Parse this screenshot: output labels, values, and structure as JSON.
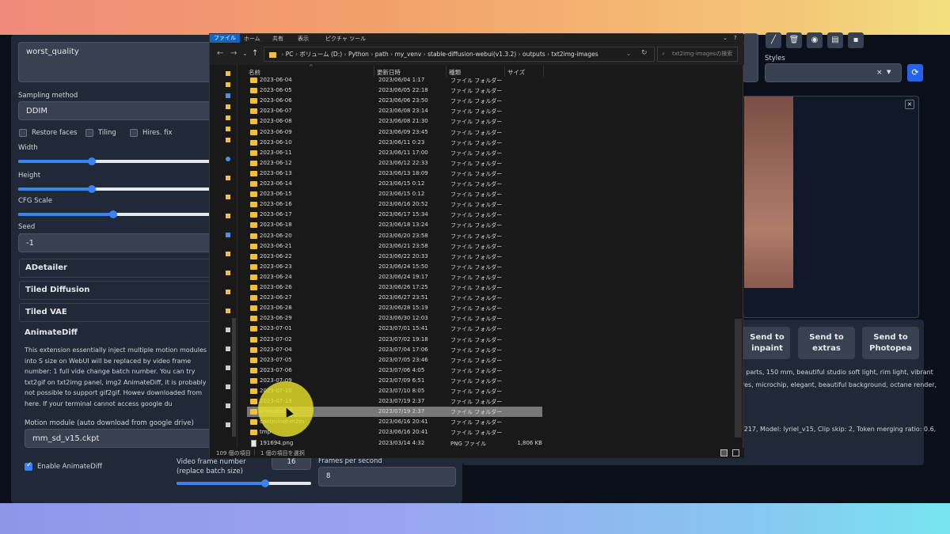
{
  "left": {
    "neg_prompt": "worst_quality",
    "sampling_label": "Sampling method",
    "sampling_value": "DDIM",
    "checks": [
      {
        "label": "Restore faces",
        "checked": false
      },
      {
        "label": "Tiling",
        "checked": false
      },
      {
        "label": "Hires. fix",
        "checked": false
      }
    ],
    "width_label": "Width",
    "height_label": "Height",
    "cfg_label": "CFG Scale",
    "seed_label": "Seed",
    "seed_value": "-1",
    "accordions": [
      "ADetailer",
      "Tiled Diffusion",
      "Tiled VAE",
      "AnimateDiff"
    ],
    "anim_text": "This extension essentially inject multiple motion modules into S size on WebUI will be replaced by video frame number: 1 full vide change batch number. You can try txt2gif on txt2img panel, img2 AnimateDiff, it is probably not possible to support gif2gif. Howev downloaded from here. If your terminal cannot access google du animatediff/model/. DO NOT change model filename.",
    "motion_label": "Motion module (auto download from google drive)",
    "motion_value": "mm_sd_v15.ckpt",
    "enable_label": "Enable AnimateDiff",
    "enable_checked": true,
    "vfn_label": "Video frame number (replace batch size)",
    "vfn_value": "16",
    "fps_label": "Frames per second",
    "fps_value": "8"
  },
  "right": {
    "toolbar_frag": "S",
    "styles_label": "Styles",
    "styles_clear": "×",
    "refresh_icon": "⟳",
    "close_icon": "×",
    "send_buttons": [
      "Send to inpaint",
      "Send to extras",
      "Send to Photopea"
    ],
    "geninfo_lines": [
      ": parts, 150 mm, beautiful studio soft light, rim light, vibrant",
      "res, microchip, elegant, beautiful background, octane render,"
    ],
    "geninfo2": ":217, Model: lyriel_v15, Clip skip: 2, Token merging ratio: 0.6,"
  },
  "explorer": {
    "ribbon": [
      "ファイル",
      "ホーム",
      "共有",
      "表示",
      "ピクチャ ツール"
    ],
    "path": [
      "PC",
      "ボリューム (D:)",
      "Python",
      "path",
      "my_venv",
      "stable-diffusion-webui(v1.3.2)",
      "outputs",
      "txt2img-images"
    ],
    "search_placeholder": "txt2img-imagesの検索",
    "columns": [
      "名前",
      "更新日時",
      "種類",
      "サイズ"
    ],
    "rows": [
      {
        "name": "2023-06-04",
        "date": "2023/06/04 1:17",
        "type": "ファイル フォルダー",
        "size": ""
      },
      {
        "name": "2023-06-05",
        "date": "2023/06/05 22:18",
        "type": "ファイル フォルダー",
        "size": ""
      },
      {
        "name": "2023-06-06",
        "date": "2023/06/06 23:50",
        "type": "ファイル フォルダー",
        "size": ""
      },
      {
        "name": "2023-06-07",
        "date": "2023/06/08 23:14",
        "type": "ファイル フォルダー",
        "size": ""
      },
      {
        "name": "2023-06-08",
        "date": "2023/06/08 21:30",
        "type": "ファイル フォルダー",
        "size": ""
      },
      {
        "name": "2023-06-09",
        "date": "2023/06/09 23:45",
        "type": "ファイル フォルダー",
        "size": ""
      },
      {
        "name": "2023-06-10",
        "date": "2023/06/11 0:23",
        "type": "ファイル フォルダー",
        "size": ""
      },
      {
        "name": "2023-06-11",
        "date": "2023/06/11 17:00",
        "type": "ファイル フォルダー",
        "size": ""
      },
      {
        "name": "2023-06-12",
        "date": "2023/06/12 22:33",
        "type": "ファイル フォルダー",
        "size": ""
      },
      {
        "name": "2023-06-13",
        "date": "2023/06/13 18:09",
        "type": "ファイル フォルダー",
        "size": ""
      },
      {
        "name": "2023-06-14",
        "date": "2023/06/15 0:12",
        "type": "ファイル フォルダー",
        "size": ""
      },
      {
        "name": "2023-06-15",
        "date": "2023/06/15 0:12",
        "type": "ファイル フォルダー",
        "size": ""
      },
      {
        "name": "2023-06-16",
        "date": "2023/06/16 20:52",
        "type": "ファイル フォルダー",
        "size": ""
      },
      {
        "name": "2023-06-17",
        "date": "2023/06/17 15:34",
        "type": "ファイル フォルダー",
        "size": ""
      },
      {
        "name": "2023-06-18",
        "date": "2023/06/18 13:24",
        "type": "ファイル フォルダー",
        "size": ""
      },
      {
        "name": "2023-06-20",
        "date": "2023/06/20 23:58",
        "type": "ファイル フォルダー",
        "size": ""
      },
      {
        "name": "2023-06-21",
        "date": "2023/06/21 23:58",
        "type": "ファイル フォルダー",
        "size": ""
      },
      {
        "name": "2023-06-22",
        "date": "2023/06/22 20:33",
        "type": "ファイル フォルダー",
        "size": ""
      },
      {
        "name": "2023-06-23",
        "date": "2023/06/24 15:50",
        "type": "ファイル フォルダー",
        "size": ""
      },
      {
        "name": "2023-06-24",
        "date": "2023/06/24 19:17",
        "type": "ファイル フォルダー",
        "size": ""
      },
      {
        "name": "2023-06-26",
        "date": "2023/06/26 17:25",
        "type": "ファイル フォルダー",
        "size": ""
      },
      {
        "name": "2023-06-27",
        "date": "2023/06/27 23:51",
        "type": "ファイル フォルダー",
        "size": ""
      },
      {
        "name": "2023-06-28",
        "date": "2023/06/28 15:19",
        "type": "ファイル フォルダー",
        "size": ""
      },
      {
        "name": "2023-06-29",
        "date": "2023/06/30 12:03",
        "type": "ファイル フォルダー",
        "size": ""
      },
      {
        "name": "2023-07-01",
        "date": "2023/07/01 15:41",
        "type": "ファイル フォルダー",
        "size": ""
      },
      {
        "name": "2023-07-02",
        "date": "2023/07/02 19:18",
        "type": "ファイル フォルダー",
        "size": ""
      },
      {
        "name": "2023-07-04",
        "date": "2023/07/04 17:06",
        "type": "ファイル フォルダー",
        "size": ""
      },
      {
        "name": "2023-07-05",
        "date": "2023/07/05 23:46",
        "type": "ファイル フォルダー",
        "size": ""
      },
      {
        "name": "2023-07-06",
        "date": "2023/07/06 4:05",
        "type": "ファイル フォルダー",
        "size": ""
      },
      {
        "name": "2023-07-09",
        "date": "2023/07/09 6:51",
        "type": "ファイル フォルダー",
        "size": ""
      },
      {
        "name": "2023-07-10",
        "date": "2023/07/10 8:05",
        "type": "ファイル フォルダー",
        "size": ""
      },
      {
        "name": "2023-07-19",
        "date": "2023/07/19 2:37",
        "type": "ファイル フォルダー",
        "size": ""
      },
      {
        "name": "AnimateDiff",
        "date": "2023/07/19 2:37",
        "type": "ファイル フォルダー",
        "size": "",
        "selected": true
      },
      {
        "name": "controlnet-m2m",
        "date": "2023/06/16 20:41",
        "type": "ファイル フォルダー",
        "size": ""
      },
      {
        "name": "tmp",
        "date": "2023/06/16 20:41",
        "type": "ファイル フォルダー",
        "size": ""
      },
      {
        "name": "191694.png",
        "date": "2023/03/14 4:32",
        "type": "PNG ファイル",
        "size": "1,806 KB",
        "file": true
      }
    ],
    "status_count": "109 個の項目",
    "status_sel": "1 個の項目を選択"
  },
  "colors": {
    "accent": "#3b82f6",
    "panel": "#1f2937",
    "folder": "#f0c040"
  }
}
